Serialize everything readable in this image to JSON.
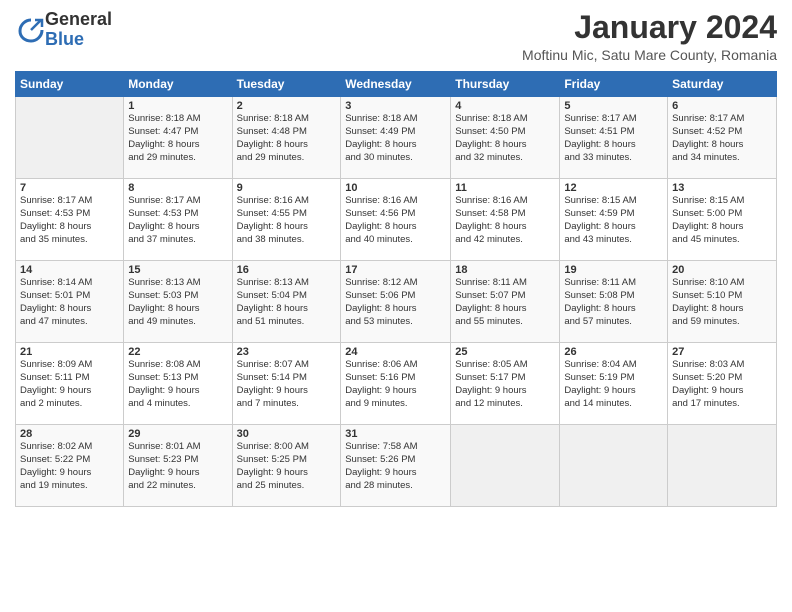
{
  "logo": {
    "general": "General",
    "blue": "Blue"
  },
  "title": "January 2024",
  "subtitle": "Moftinu Mic, Satu Mare County, Romania",
  "days_of_week": [
    "Sunday",
    "Monday",
    "Tuesday",
    "Wednesday",
    "Thursday",
    "Friday",
    "Saturday"
  ],
  "weeks": [
    [
      {
        "day": "",
        "info": ""
      },
      {
        "day": "1",
        "info": "Sunrise: 8:18 AM\nSunset: 4:47 PM\nDaylight: 8 hours\nand 29 minutes."
      },
      {
        "day": "2",
        "info": "Sunrise: 8:18 AM\nSunset: 4:48 PM\nDaylight: 8 hours\nand 29 minutes."
      },
      {
        "day": "3",
        "info": "Sunrise: 8:18 AM\nSunset: 4:49 PM\nDaylight: 8 hours\nand 30 minutes."
      },
      {
        "day": "4",
        "info": "Sunrise: 8:18 AM\nSunset: 4:50 PM\nDaylight: 8 hours\nand 32 minutes."
      },
      {
        "day": "5",
        "info": "Sunrise: 8:17 AM\nSunset: 4:51 PM\nDaylight: 8 hours\nand 33 minutes."
      },
      {
        "day": "6",
        "info": "Sunrise: 8:17 AM\nSunset: 4:52 PM\nDaylight: 8 hours\nand 34 minutes."
      }
    ],
    [
      {
        "day": "7",
        "info": ""
      },
      {
        "day": "8",
        "info": "Sunrise: 8:17 AM\nSunset: 4:53 PM\nDaylight: 8 hours\nand 37 minutes."
      },
      {
        "day": "9",
        "info": "Sunrise: 8:16 AM\nSunset: 4:55 PM\nDaylight: 8 hours\nand 38 minutes."
      },
      {
        "day": "10",
        "info": "Sunrise: 8:16 AM\nSunset: 4:56 PM\nDaylight: 8 hours\nand 40 minutes."
      },
      {
        "day": "11",
        "info": "Sunrise: 8:16 AM\nSunset: 4:58 PM\nDaylight: 8 hours\nand 42 minutes."
      },
      {
        "day": "12",
        "info": "Sunrise: 8:15 AM\nSunset: 4:59 PM\nDaylight: 8 hours\nand 43 minutes."
      },
      {
        "day": "13",
        "info": "Sunrise: 8:15 AM\nSunset: 5:00 PM\nDaylight: 8 hours\nand 45 minutes."
      }
    ],
    [
      {
        "day": "14",
        "info": ""
      },
      {
        "day": "15",
        "info": "Sunrise: 8:13 AM\nSunset: 5:03 PM\nDaylight: 8 hours\nand 49 minutes."
      },
      {
        "day": "16",
        "info": "Sunrise: 8:13 AM\nSunset: 5:04 PM\nDaylight: 8 hours\nand 51 minutes."
      },
      {
        "day": "17",
        "info": "Sunrise: 8:12 AM\nSunset: 5:06 PM\nDaylight: 8 hours\nand 53 minutes."
      },
      {
        "day": "18",
        "info": "Sunrise: 8:11 AM\nSunset: 5:07 PM\nDaylight: 8 hours\nand 55 minutes."
      },
      {
        "day": "19",
        "info": "Sunrise: 8:11 AM\nSunset: 5:08 PM\nDaylight: 8 hours\nand 57 minutes."
      },
      {
        "day": "20",
        "info": "Sunrise: 8:10 AM\nSunset: 5:10 PM\nDaylight: 8 hours\nand 59 minutes."
      }
    ],
    [
      {
        "day": "21",
        "info": "Sunrise: 8:09 AM\nSunset: 5:11 PM\nDaylight: 9 hours\nand 2 minutes."
      },
      {
        "day": "22",
        "info": "Sunrise: 8:08 AM\nSunset: 5:13 PM\nDaylight: 9 hours\nand 4 minutes."
      },
      {
        "day": "23",
        "info": "Sunrise: 8:07 AM\nSunset: 5:14 PM\nDaylight: 9 hours\nand 7 minutes."
      },
      {
        "day": "24",
        "info": "Sunrise: 8:06 AM\nSunset: 5:16 PM\nDaylight: 9 hours\nand 9 minutes."
      },
      {
        "day": "25",
        "info": "Sunrise: 8:05 AM\nSunset: 5:17 PM\nDaylight: 9 hours\nand 12 minutes."
      },
      {
        "day": "26",
        "info": "Sunrise: 8:04 AM\nSunset: 5:19 PM\nDaylight: 9 hours\nand 14 minutes."
      },
      {
        "day": "27",
        "info": "Sunrise: 8:03 AM\nSunset: 5:20 PM\nDaylight: 9 hours\nand 17 minutes."
      }
    ],
    [
      {
        "day": "28",
        "info": "Sunrise: 8:02 AM\nSunset: 5:22 PM\nDaylight: 9 hours\nand 19 minutes."
      },
      {
        "day": "29",
        "info": "Sunrise: 8:01 AM\nSunset: 5:23 PM\nDaylight: 9 hours\nand 22 minutes."
      },
      {
        "day": "30",
        "info": "Sunrise: 8:00 AM\nSunset: 5:25 PM\nDaylight: 9 hours\nand 25 minutes."
      },
      {
        "day": "31",
        "info": "Sunrise: 7:58 AM\nSunset: 5:26 PM\nDaylight: 9 hours\nand 28 minutes."
      },
      {
        "day": "",
        "info": ""
      },
      {
        "day": "",
        "info": ""
      },
      {
        "day": "",
        "info": ""
      }
    ]
  ],
  "week2_day7_info": "Sunrise: 8:17 AM\nSunset: 4:53 PM\nDaylight: 8 hours\nand 35 minutes.",
  "week3_day14_info": "Sunrise: 8:14 AM\nSunset: 5:01 PM\nDaylight: 8 hours\nand 47 minutes."
}
